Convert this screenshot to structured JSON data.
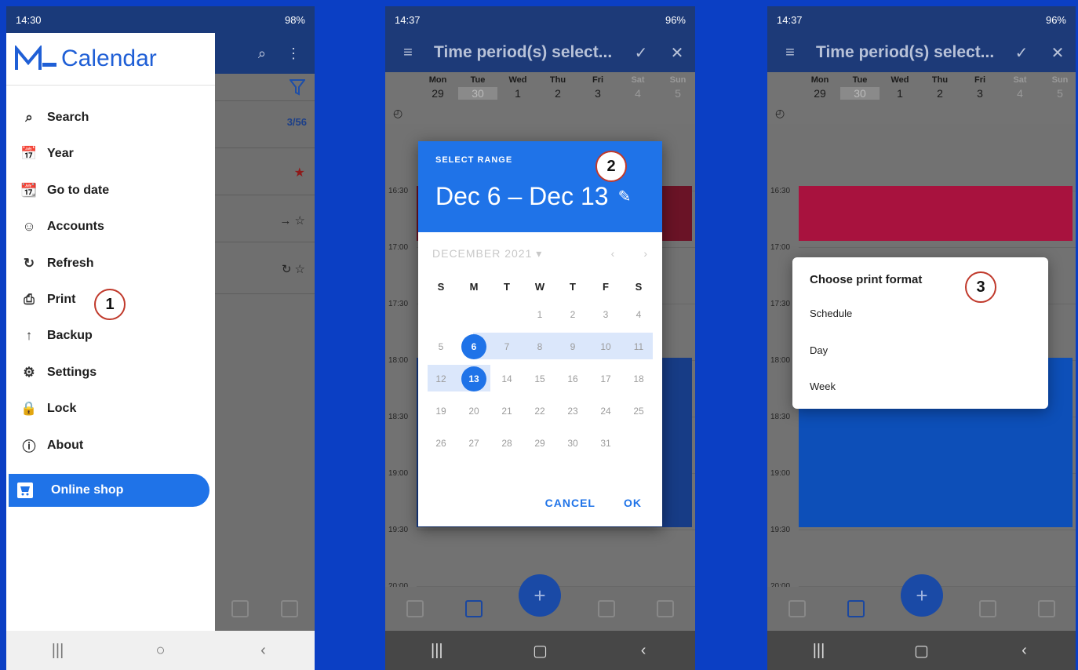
{
  "phone1": {
    "status_time": "14:30",
    "status_right": "98%",
    "app_title": "Calendar",
    "bg_count": "3/56",
    "menu": [
      {
        "label": "Search",
        "icon": "search-icon"
      },
      {
        "label": "Year",
        "icon": "calendar-year-icon"
      },
      {
        "label": "Go to date",
        "icon": "calendar-search-icon"
      },
      {
        "label": "Accounts",
        "icon": "person-icon"
      },
      {
        "label": "Refresh",
        "icon": "refresh-icon"
      },
      {
        "label": "Print",
        "icon": "printer-icon"
      },
      {
        "label": "Backup",
        "icon": "upload-icon"
      },
      {
        "label": "Settings",
        "icon": "gear-icon"
      },
      {
        "label": "Lock",
        "icon": "lock-icon"
      },
      {
        "label": "About",
        "icon": "info-icon"
      }
    ],
    "online_shop": "Online shop",
    "step": "1"
  },
  "phone2": {
    "status_time": "14:37",
    "status_right": "96%",
    "toolbar_title": "Time period(s) select...",
    "week": [
      {
        "name": "Mon",
        "date": "29"
      },
      {
        "name": "Tue",
        "date": "30"
      },
      {
        "name": "Wed",
        "date": "1"
      },
      {
        "name": "Thu",
        "date": "2"
      },
      {
        "name": "Fri",
        "date": "3"
      },
      {
        "name": "Sat",
        "date": "4"
      },
      {
        "name": "Sun",
        "date": "5"
      }
    ],
    "times": [
      "16:30",
      "17:00",
      "17:30",
      "18:00",
      "18:30",
      "19:00",
      "19:30",
      "20:00"
    ],
    "dialog": {
      "label": "SELECT RANGE",
      "range": "Dec 6 – Dec 13",
      "month": "DECEMBER 2021",
      "weekdays": [
        "S",
        "M",
        "T",
        "W",
        "T",
        "F",
        "S"
      ],
      "rows": [
        [
          "",
          "",
          "",
          "1",
          "2",
          "3",
          "4"
        ],
        [
          "5",
          "6",
          "7",
          "8",
          "9",
          "10",
          "11"
        ],
        [
          "12",
          "13",
          "14",
          "15",
          "16",
          "17",
          "18"
        ],
        [
          "19",
          "20",
          "21",
          "22",
          "23",
          "24",
          "25"
        ],
        [
          "26",
          "27",
          "28",
          "29",
          "30",
          "31",
          ""
        ]
      ],
      "cancel": "CANCEL",
      "ok": "OK"
    },
    "step": "2"
  },
  "phone3": {
    "status_time": "14:37",
    "status_right": "96%",
    "toolbar_title": "Time period(s) select...",
    "print_title": "Choose print format",
    "options": [
      "Schedule",
      "Day",
      "Week"
    ],
    "step": "3"
  },
  "colors": {
    "accent": "#1f73e8",
    "background": "#0b3fc4",
    "annotation_circle": "#c0392b"
  }
}
